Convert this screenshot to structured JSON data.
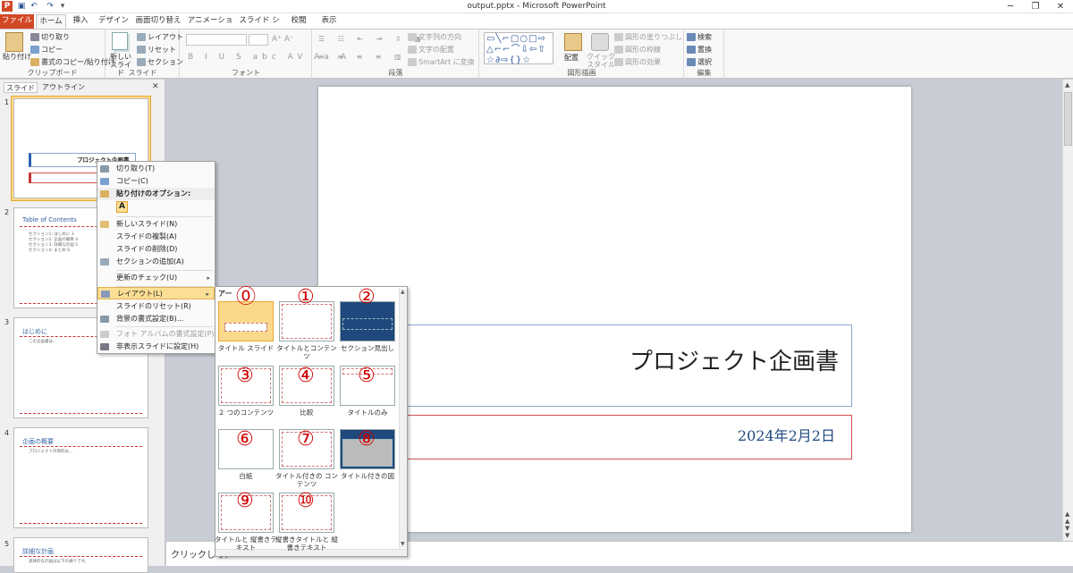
{
  "window": {
    "title": "output.pptx - Microsoft PowerPoint",
    "minimize": "─",
    "restore": "❐",
    "close": "✕"
  },
  "tabs": [
    "ファイル",
    "ホーム",
    "挿入",
    "デザイン",
    "画面切り替え",
    "アニメーション",
    "スライド ショー",
    "校閲",
    "表示"
  ],
  "ribbon": {
    "clipboard": {
      "paste": "貼り付け",
      "cut": "切り取り",
      "copy": "コピー",
      "format_painter": "書式のコピー/貼り付け",
      "label": "クリップボード"
    },
    "slides": {
      "new_slide": "新しい スライド",
      "layout": "レイアウト",
      "reset": "リセット",
      "section": "セクション",
      "label": "スライド"
    },
    "font": {
      "label": "フォント"
    },
    "paragraph": {
      "text_direction": "文字列の方向",
      "align_text": "文字の配置",
      "smartart": "SmartArt に変換",
      "label": "段落"
    },
    "drawing": {
      "arrange": "配置",
      "quick_styles": "クイック スタイル",
      "fill": "図形の塗りつぶし",
      "outline": "図形の枠線",
      "effects": "図形の効果",
      "label": "図形描画"
    },
    "editing": {
      "find": "検索",
      "replace": "置換",
      "select": "選択",
      "label": "編集"
    }
  },
  "pane_tabs": [
    "スライド",
    "アウトライン"
  ],
  "thumbnails": [
    {
      "num": "1",
      "title": "プロジェクト企画書"
    },
    {
      "num": "2",
      "title": "Table of Contents",
      "lines": [
        "セクション1: はじめに 3",
        "セクション2: 企画の概要 4",
        "セクション3: 詳細な計画 5",
        "セクション4: まとめ 6"
      ]
    },
    {
      "num": "3",
      "title": "はじめに",
      "lines": [
        "この企画書は..."
      ]
    },
    {
      "num": "4",
      "title": "企画の概要",
      "lines": [
        "プロジェクトの目的は..."
      ]
    },
    {
      "num": "5",
      "title": "詳細な計画",
      "lines": [
        "具体的な計画は以下の通りです。"
      ]
    }
  ],
  "slide": {
    "title": "プロジェクト企画書",
    "subtitle": "2024年2月2日"
  },
  "notes": {
    "placeholder": "クリックしてノ"
  },
  "context_menu": {
    "cut": "切り取り(T)",
    "copy": "コピー(C)",
    "paste_options": "貼り付けのオプション:",
    "paste_icon": "A",
    "new_slide": "新しいスライド(N)",
    "duplicate": "スライドの複製(A)",
    "delete": "スライドの削除(D)",
    "add_section": "セクションの追加(A)",
    "check_updates": "更新のチェック(U)",
    "layout": "レイアウト(L)",
    "reset": "スライドのリセット(R)",
    "background": "背景の書式設定(B)...",
    "photo_album": "フォト アルバムの書式設定(P)...",
    "hide": "非表示スライドに設定(H)"
  },
  "gallery": {
    "header": "アー",
    "layouts": [
      {
        "num": "⓪",
        "label": "タイトル スライド"
      },
      {
        "num": "①",
        "label": "タイトルとコンテンツ"
      },
      {
        "num": "②",
        "label": "セクション見出し"
      },
      {
        "num": "③",
        "label": "２ つのコンテンツ"
      },
      {
        "num": "④",
        "label": "比較"
      },
      {
        "num": "⑤",
        "label": "タイトルのみ"
      },
      {
        "num": "⑥",
        "label": "白紙"
      },
      {
        "num": "⑦",
        "label": "タイトル付きの コンテンツ"
      },
      {
        "num": "⑧",
        "label": "タイトル付きの図"
      },
      {
        "num": "⑨",
        "label": "タイトルと 縦書きテキスト"
      },
      {
        "num": "⑩",
        "label": "縦書きタイトルと 縦書きテキスト"
      }
    ]
  },
  "colors": {
    "file_tab": "#d24726",
    "slide_title_border": "#8aa6d0",
    "slide_sub_border": "#d05050",
    "subtitle_text": "#1f497d",
    "annotation": "#d10000",
    "highlight": "#fcdf95"
  }
}
